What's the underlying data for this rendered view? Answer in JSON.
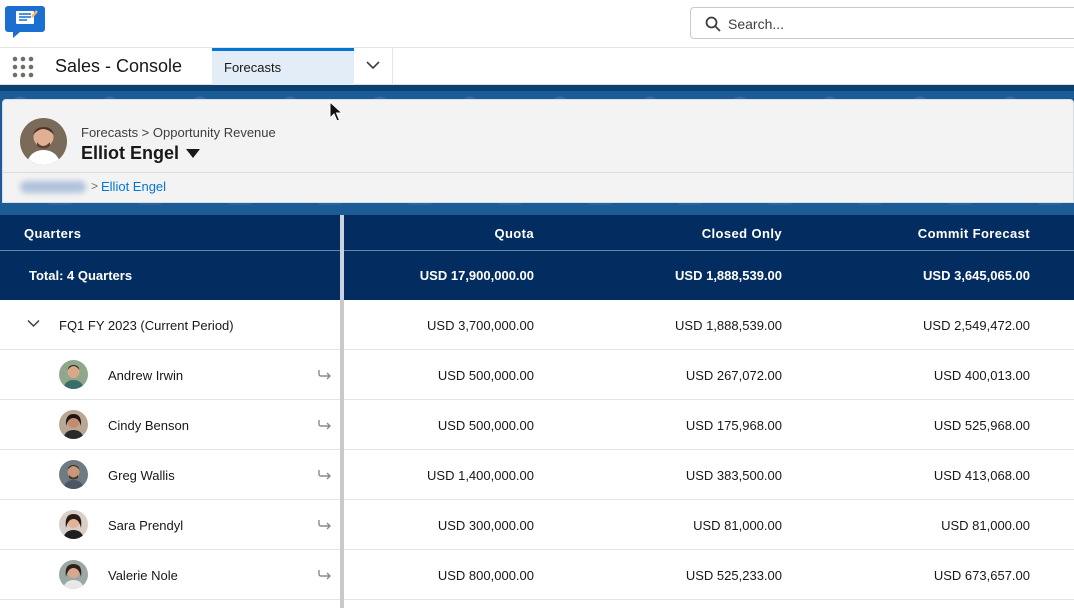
{
  "header": {
    "search_placeholder": "Search...",
    "logo_icon": "app-logo-icon"
  },
  "nav": {
    "app_name": "Sales - Console",
    "tab_label": "Forecasts"
  },
  "page": {
    "breadcrumb_top": "Forecasts > Opportunity Revenue",
    "owner_name": "Elliot Engel",
    "breadcrumb_sep": ">",
    "breadcrumb_current": "Elliot Engel"
  },
  "table": {
    "columns": {
      "quarters": "Quarters",
      "quota": "Quota",
      "closed": "Closed Only",
      "commit": "Commit Forecast"
    },
    "total": {
      "label": "Total: 4 Quarters",
      "quota": "USD 17,900,000.00",
      "closed": "USD 1,888,539.00",
      "commit": "USD 3,645,065.00"
    },
    "period": {
      "label": "FQ1 FY 2023 (Current Period)",
      "quota": "USD 3,700,000.00",
      "closed": "USD 1,888,539.00",
      "commit": "USD 2,549,472.00"
    },
    "rows": [
      {
        "name": "Andrew Irwin",
        "quota": "USD 500,000.00",
        "closed": "USD 267,072.00",
        "commit": "USD 400,013.00"
      },
      {
        "name": "Cindy Benson",
        "quota": "USD 500,000.00",
        "closed": "USD 175,968.00",
        "commit": "USD 525,968.00"
      },
      {
        "name": "Greg Wallis",
        "quota": "USD 1,400,000.00",
        "closed": "USD 383,500.00",
        "commit": "USD 413,068.00"
      },
      {
        "name": "Sara Prendyl",
        "quota": "USD 300,000.00",
        "closed": "USD 81,000.00",
        "commit": "USD 81,000.00"
      },
      {
        "name": "Valerie Nole",
        "quota": "USD 800,000.00",
        "closed": "USD 525,233.00",
        "commit": "USD 673,657.00"
      }
    ]
  },
  "colors": {
    "brand_blue": "#0176d3",
    "header_navy": "#032d60"
  }
}
